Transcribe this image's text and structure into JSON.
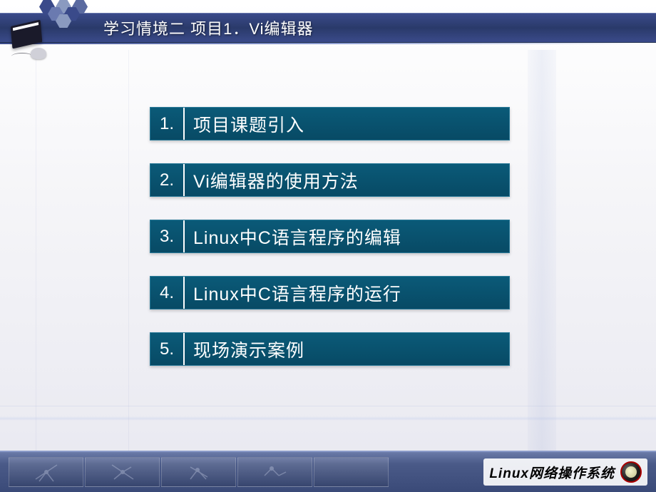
{
  "header": {
    "title": "学习情境二  项目1．Vi编辑器"
  },
  "menu": {
    "items": [
      {
        "num": "1.",
        "label": "项目课题引入"
      },
      {
        "num": "2.",
        "label": "Vi编辑器的使用方法"
      },
      {
        "num": "3.",
        "label": "Linux中C语言程序的编辑"
      },
      {
        "num": "4.",
        "label": "Linux中C语言程序的运行"
      },
      {
        "num": "5.",
        "label": "现场演示案例"
      }
    ]
  },
  "footer": {
    "brand": "Linux网络操作系统"
  }
}
